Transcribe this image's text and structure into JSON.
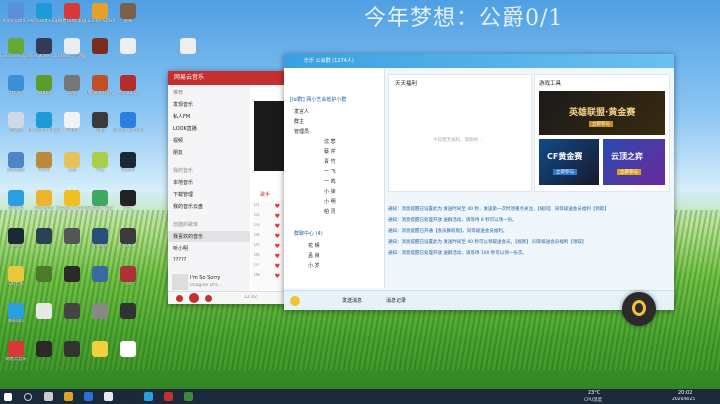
{
  "desktop": {
    "wallpaper_text": "今年梦想：公爵0/1",
    "icons": [
      {
        "label": "Administra...",
        "color": "#5b8fd6"
      },
      {
        "label": "Microsoft Edge",
        "color": "#1f9ad8"
      },
      {
        "label": "网易UU加速器",
        "color": "#d93838"
      },
      {
        "label": "Counter-Strike",
        "color": "#e5a028"
      },
      {
        "label": "逃离",
        "color": "#7a6048"
      },
      {
        "label": "GeForce Experience",
        "color": "#65a93a"
      },
      {
        "label": "Alienware Command",
        "color": "#333a55"
      },
      {
        "label": "Steam 启动器",
        "color": "#e9edf1"
      },
      {
        "label": "",
        "color": "#7c2d1f"
      },
      {
        "label": "",
        "color": "#eeeeee"
      },
      {
        "label": "此电脑",
        "color": "#3c8fd8"
      },
      {
        "label": "NVIDIA",
        "color": "#5b9d2a"
      },
      {
        "label": "Gay",
        "color": "#777777"
      },
      {
        "label": "Paused Party",
        "color": "#c0502a"
      },
      {
        "label": "Among Us",
        "color": "#b22d2d"
      },
      {
        "label": "回收站",
        "color": "#cfd8e4"
      },
      {
        "label": "Microsoft Edge",
        "color": "#1f9ad8"
      },
      {
        "label": "Fonts",
        "color": "#f2f2f2"
      },
      {
        "label": "Halo",
        "color": "#3a3a3a"
      },
      {
        "label": "Google Chrome",
        "color": "#2c7de2"
      },
      {
        "label": "控制面板",
        "color": "#4a86c8"
      },
      {
        "label": "PUBG",
        "color": "#b88a3a"
      },
      {
        "label": "文档",
        "color": "#e6c35a"
      },
      {
        "label": "Tiny",
        "color": "#a8d04a"
      },
      {
        "label": "Steam",
        "color": "#1b2838"
      },
      {
        "label": "腾讯QQ",
        "color": "#2a9fe0"
      },
      {
        "label": "WeGame",
        "color": "#eeb42d"
      },
      {
        "label": "Google Chrome",
        "color": "#f0c020"
      },
      {
        "label": "Google Play",
        "color": "#3ea860"
      },
      {
        "label": "EPIC",
        "color": "#222222"
      },
      {
        "label": "Steam",
        "color": "#1b2838"
      },
      {
        "label": "",
        "color": "#2a4055"
      },
      {
        "label": "",
        "color": "#555555"
      },
      {
        "label": "Vivaldi",
        "color": "#2a4e7a"
      },
      {
        "label": "WAR",
        "color": "#3a3a3a"
      },
      {
        "label": "QQ音乐",
        "color": "#e8c83a"
      },
      {
        "label": "",
        "color": "#4a7a2a"
      },
      {
        "label": "",
        "color": "#2a2a2a"
      },
      {
        "label": "",
        "color": "#3a6aa0"
      },
      {
        "label": "TIX",
        "color": "#aa3333"
      },
      {
        "label": "腾讯QQ",
        "color": "#2a9fe0"
      },
      {
        "label": "",
        "color": "#e8e8e8"
      },
      {
        "label": "",
        "color": "#444444"
      },
      {
        "label": "",
        "color": "#888888"
      },
      {
        "label": "",
        "color": "#333333"
      },
      {
        "label": "网易云音乐",
        "color": "#d93838"
      },
      {
        "label": "",
        "color": "#2a2a2a"
      },
      {
        "label": "",
        "color": "#333333"
      },
      {
        "label": "",
        "color": "#f0d040"
      },
      {
        "label": "",
        "color": "#ffffff"
      }
    ]
  },
  "music": {
    "title": "网易云音乐",
    "sidebar": [
      "推荐",
      "发现音乐",
      "私人FM",
      "LOOK直播",
      "视频",
      "朋友",
      "我的音乐",
      "本地音乐",
      "下载管理",
      "我的音乐云盘",
      "创建的歌单",
      "我喜欢的音乐",
      "听小明",
      "?????"
    ],
    "tab": "歌手",
    "rows": [
      "01",
      "02",
      "03",
      "04",
      "05",
      "06",
      "07",
      "08"
    ],
    "song": "I'm So Sorry",
    "artist": "Imagine Dra...",
    "time": "03:56",
    "cur": "12:42"
  },
  "qq": {
    "title": "乐乐 公会群 (1274人)",
    "group_name": "[lol群] 网小艺会抵护小群",
    "members": [
      "发言人",
      "群主",
      "管理员",
      "沈 悲",
      "蔡 芹",
      "青 竹",
      "一 飞",
      "一 鸣",
      "小 柒",
      "小 明",
      "柏 灵",
      "花 晴",
      "孟 良",
      "小 岁"
    ],
    "section2": "群聊中心 (4)",
    "notice_tab": "天天福利",
    "notice_placeholder": "今日暂无福利，请期待...",
    "games_tab": "游戏工具",
    "ad1": "英雄联盟·黄金赛",
    "ad1_btn": "立即参与",
    "ad2": "CF黄金赛",
    "ad2_btn": "立即参与",
    "ad3": "云顶之弈",
    "ad3_btn": "立即参与",
    "chat": [
      "通知：消息提醒已设置此为 发送时间至 40 秒，发送第一次时须重点关注，【规则】 同等级送会员福利【领取】",
      "通知：消息提醒已处理开放 送群活动，请等待 8 秒可以领一份。",
      "通知：消息提醒已开通【会员群权限】，同等级送会员福利。",
      "通知：消息提醒已设置此为 发送时间至 40 秒可以领取送会员，【规则】 同等级送会员福利【领取】",
      "通知：消息提醒已处理开放 送群活动，请等待 100 秒可以领一份次。"
    ],
    "toolbar": [
      "发送消息",
      "消息记录"
    ]
  },
  "taskbar": {
    "search": "搜索",
    "temp": "23°C",
    "weather": "CPU温度",
    "time": "20:02",
    "date": "2020/8/25"
  }
}
